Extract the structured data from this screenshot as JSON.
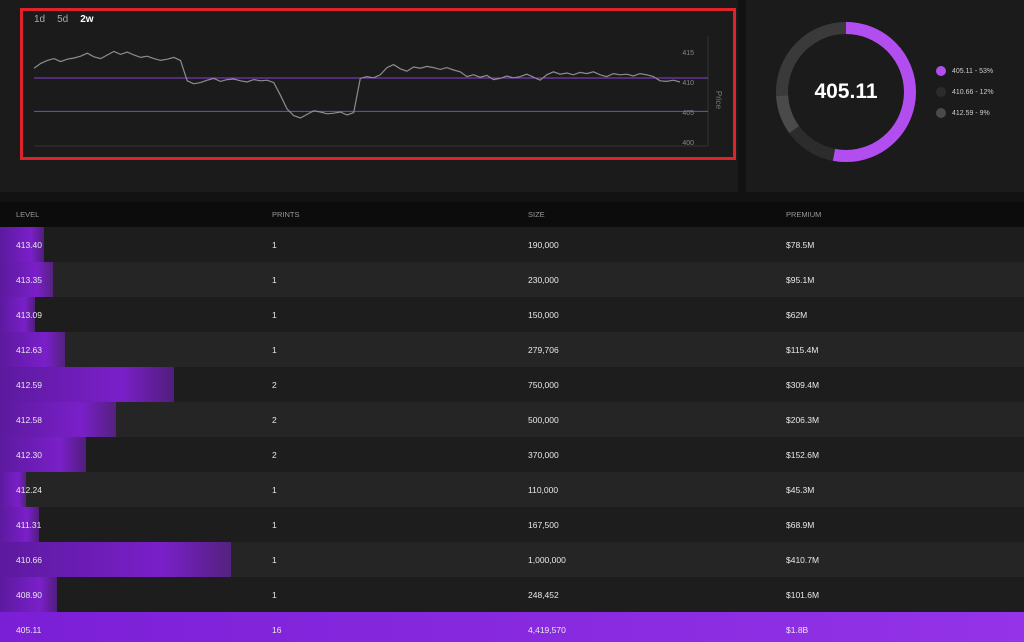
{
  "chart": {
    "tabs": [
      {
        "label": "1d",
        "active": false
      },
      {
        "label": "5d",
        "active": false
      },
      {
        "label": "2w",
        "active": true
      }
    ],
    "y_axis_label": "Price",
    "y_ticks": [
      400,
      405,
      410,
      415
    ],
    "y_range": [
      399,
      417
    ],
    "ref_lines": [
      410.66,
      405.11
    ],
    "prices": [
      412.3,
      413.1,
      413.6,
      413.9,
      413.4,
      413.8,
      414.0,
      414.3,
      414.8,
      414.2,
      413.9,
      414.5,
      415.1,
      414.6,
      415.0,
      414.5,
      414.1,
      414.3,
      413.9,
      413.6,
      413.8,
      414.1,
      413.6,
      410.2,
      409.7,
      409.9,
      410.3,
      410.6,
      410.1,
      410.4,
      410.5,
      410.2,
      410.0,
      410.4,
      410.2,
      410.3,
      409.9,
      407.8,
      405.5,
      404.4,
      404.0,
      404.6,
      405.2,
      405.0,
      404.7,
      404.8,
      405.0,
      404.5,
      404.9,
      410.6,
      410.9,
      410.7,
      411.2,
      412.4,
      412.9,
      412.2,
      411.8,
      412.5,
      412.3,
      412.6,
      412.4,
      412.1,
      412.4,
      412.0,
      411.7,
      410.9,
      411.2,
      410.8,
      411.1,
      410.4,
      410.6,
      411.0,
      410.7,
      410.9,
      411.3,
      410.8,
      410.3,
      411.2,
      411.7,
      411.3,
      411.5,
      411.2,
      411.6,
      411.4,
      411.7,
      411.2,
      410.9,
      411.4,
      411.2,
      411.3,
      411.0,
      411.4,
      411.2,
      410.9,
      410.2,
      410.1,
      410.3,
      410.0
    ]
  },
  "donut": {
    "center_value": "405.11",
    "segments": [
      {
        "label": "405.11 - 53%",
        "percent": 53,
        "color": "#b24ef0"
      },
      {
        "label": "410.66 - 12%",
        "percent": 12,
        "color": "#2c2c2c"
      },
      {
        "label": "412.59 - 9%",
        "percent": 9,
        "color": "#4a4a4a"
      }
    ],
    "remainder_color": "#3a3a3a"
  },
  "table": {
    "headers": [
      "LEVEL",
      "PRINTS",
      "SIZE",
      "PREMIUM"
    ],
    "rows": [
      {
        "level": "413.40",
        "prints": "1",
        "size": "190,000",
        "premium": "$78.5M",
        "share": 0.043
      },
      {
        "level": "413.35",
        "prints": "1",
        "size": "230,000",
        "premium": "$95.1M",
        "share": 0.052
      },
      {
        "level": "413.09",
        "prints": "1",
        "size": "150,000",
        "premium": "$62M",
        "share": 0.034
      },
      {
        "level": "412.63",
        "prints": "1",
        "size": "279,706",
        "premium": "$115.4M",
        "share": 0.063
      },
      {
        "level": "412.59",
        "prints": "2",
        "size": "750,000",
        "premium": "$309.4M",
        "share": 0.17
      },
      {
        "level": "412.58",
        "prints": "2",
        "size": "500,000",
        "premium": "$206.3M",
        "share": 0.113
      },
      {
        "level": "412.30",
        "prints": "2",
        "size": "370,000",
        "premium": "$152.6M",
        "share": 0.084
      },
      {
        "level": "412.24",
        "prints": "1",
        "size": "110,000",
        "premium": "$45.3M",
        "share": 0.025
      },
      {
        "level": "411.31",
        "prints": "1",
        "size": "167,500",
        "premium": "$68.9M",
        "share": 0.038
      },
      {
        "level": "410.66",
        "prints": "1",
        "size": "1,000,000",
        "premium": "$410.7M",
        "share": 0.226
      },
      {
        "level": "408.90",
        "prints": "1",
        "size": "248,452",
        "premium": "$101.6M",
        "share": 0.056
      },
      {
        "level": "405.11",
        "prints": "16",
        "size": "4,419,570",
        "premium": "$1.8B",
        "share": 1.0
      }
    ]
  }
}
